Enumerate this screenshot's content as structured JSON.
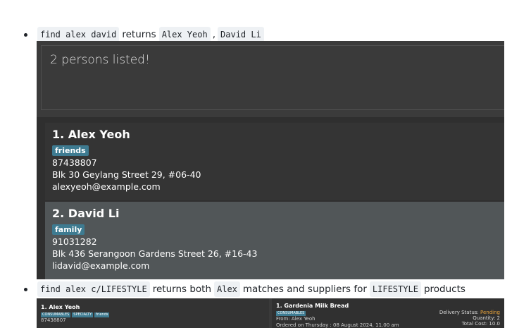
{
  "bullet1": {
    "cmd": "find alex david",
    "returns": "returns",
    "name1": "Alex Yeoh",
    "comma": ",",
    "name2": "David Li"
  },
  "result_box": {
    "text": "2 persons listed!"
  },
  "persons": [
    {
      "name": "1.  Alex Yeoh",
      "tag": "friends",
      "phone": "87438807",
      "address": "Blk 30 Geylang Street 29, #06-40",
      "email": "alexyeoh@example.com"
    },
    {
      "name": "2.  David Li",
      "tag": "family",
      "phone": "91031282",
      "address": "Blk 436 Serangoon Gardens Street 26, #16-43",
      "email": "lidavid@example.com"
    }
  ],
  "bullet2": {
    "cmd": "find alex c/LIFESTYLE",
    "returns_both": "returns both",
    "alex": "Alex",
    "matches": "matches and suppliers for",
    "lifestyle": "LIFESTYLE",
    "products": "products"
  },
  "panel2": {
    "left": {
      "name": "1. Alex Yeoh",
      "tags": [
        "CONSUMABLES",
        "SPECIALTY",
        "friends"
      ],
      "phone": "87438807"
    },
    "right": {
      "product": "1. Gardenia Milk Bread",
      "tag": "CONSUMABLES",
      "from": "From: Alex Yeoh",
      "ordered": "Ordered on Thursday : 08 August 2024, 11.00 am",
      "delivery_label": "Delivery Status:",
      "delivery_value": "Pending",
      "quantity": "Quantity: 2",
      "total_cost": "Total Cost: 10.0"
    }
  },
  "colors": {
    "tag_bg": "#3e7b91",
    "pending": "#e8a33a",
    "selected_card": "#515658"
  }
}
